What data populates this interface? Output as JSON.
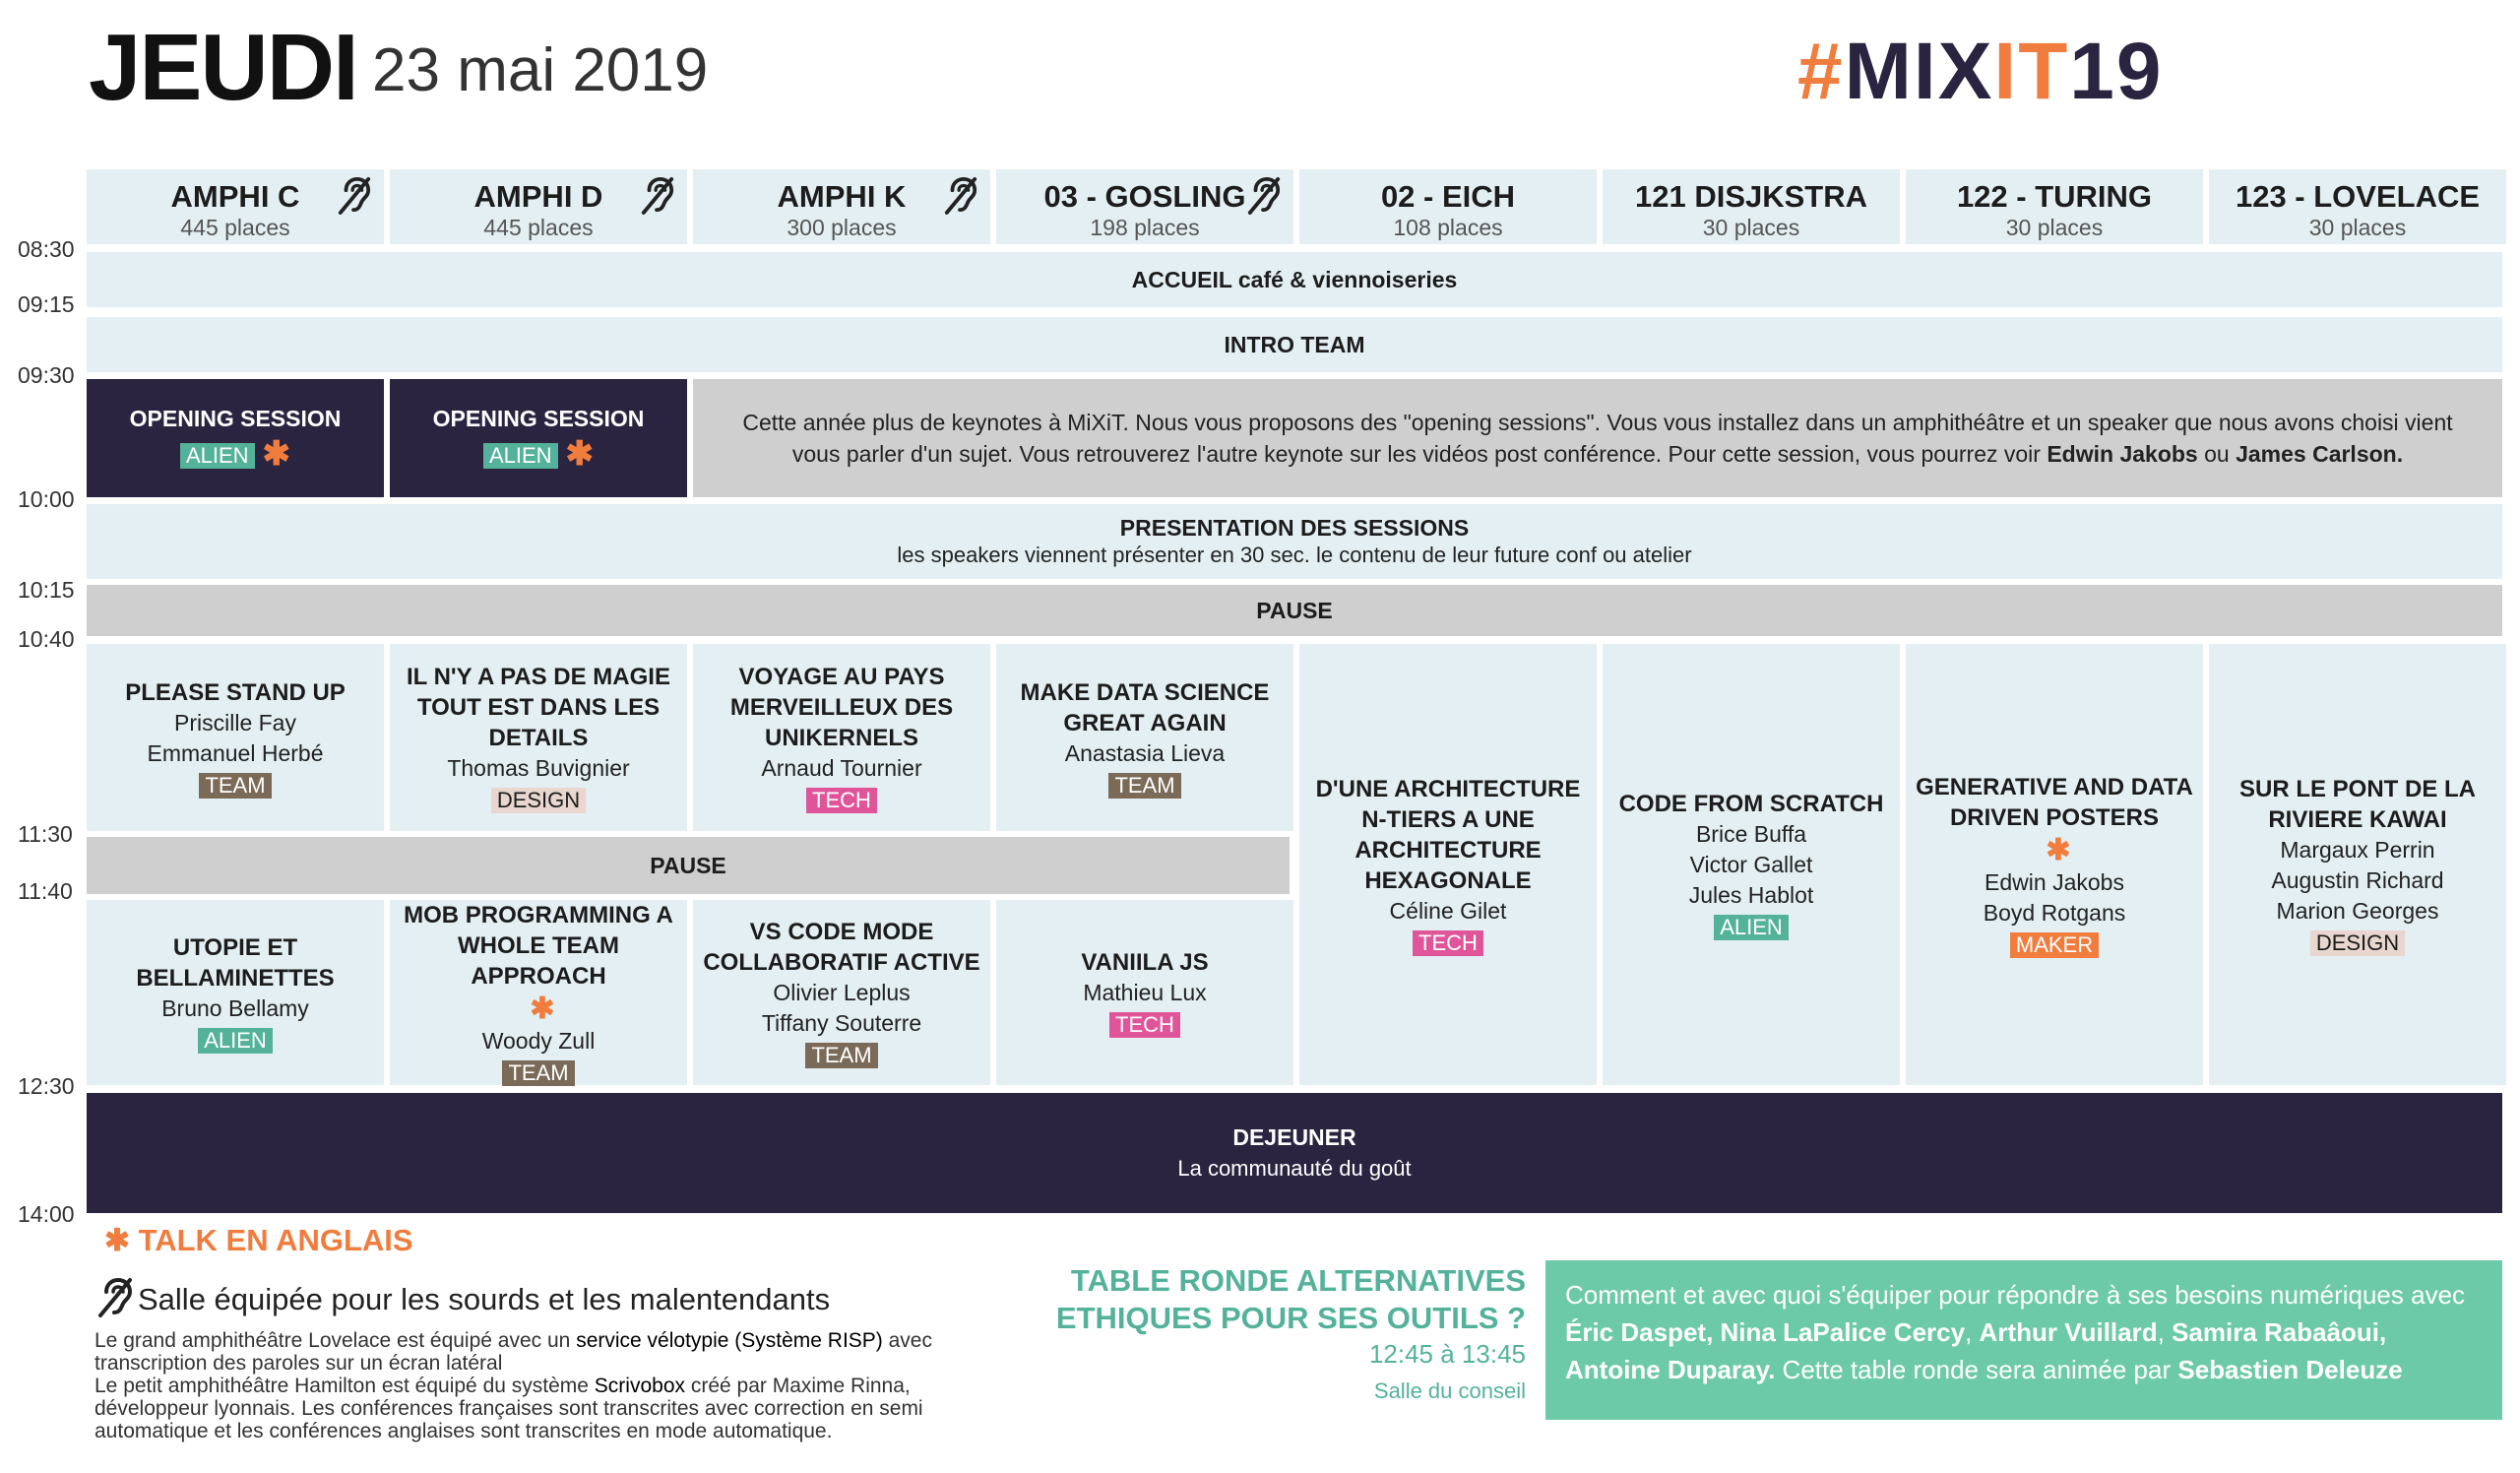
{
  "header": {
    "day": "JEUDI",
    "date": "23 mai 2019",
    "brand_hash": "#",
    "brand_mi": "MI",
    "brand_x": "X",
    "brand_it": "IT",
    "brand_num": "19"
  },
  "rooms": [
    {
      "name": "AMPHI C",
      "places": "445 places",
      "accessible": true
    },
    {
      "name": "AMPHI D",
      "places": "445 places",
      "accessible": true
    },
    {
      "name": "AMPHI K",
      "places": "300 places",
      "accessible": true
    },
    {
      "name": "03 - GOSLING",
      "places": "198 places",
      "accessible": true
    },
    {
      "name": "02 - EICH",
      "places": "108 places",
      "accessible": false
    },
    {
      "name": "121 DISJKSTRA",
      "places": "30 places",
      "accessible": false
    },
    {
      "name": "122 - TURING",
      "places": "30 places",
      "accessible": false
    },
    {
      "name": "123 - LOVELACE",
      "places": "30 places",
      "accessible": false
    }
  ],
  "times": [
    "08:30",
    "09:15",
    "09:30",
    "10:00",
    "10:15",
    "10:40",
    "11:30",
    "11:40",
    "12:30",
    "14:00"
  ],
  "plenary": {
    "accueil": "ACCUEIL café & viennoiseries",
    "intro": "INTRO TEAM",
    "presentation_title": "PRESENTATION DES SESSIONS",
    "presentation_sub": "les speakers viennent présenter en 30 sec. le contenu de leur future conf ou atelier",
    "pause1": "PAUSE",
    "pause2": "PAUSE",
    "dejeuner_title": "DEJEUNER",
    "dejeuner_sub": "La communauté du goût"
  },
  "opening": [
    {
      "title": "OPENING SESSION",
      "tag": "ALIEN",
      "english": true
    },
    {
      "title": "OPENING SESSION",
      "tag": "ALIEN",
      "english": true
    }
  ],
  "keynote_note": {
    "text1": "Cette année plus de keynotes à MiXiT. Nous vous proposons des \"opening sessions\". Vous vous installez dans un amphithéâtre et un speaker que nous avons choisi vient vous parler d'un sujet. Vous retrouverez l'autre keynote sur les vidéos post conférence. Pour cette session, vous pourrez voir ",
    "name1": "Edwin Jakobs",
    "text2": " ou  ",
    "name2": "James Carlson."
  },
  "sessions_morning": [
    {
      "title": "PLEASE STAND UP",
      "speakers": [
        "Priscille Fay",
        "Emmanuel Herbé"
      ],
      "tag": "TEAM"
    },
    {
      "title": "IL N'Y A PAS DE MAGIE TOUT EST DANS LES DETAILS",
      "speakers": [
        "Thomas Buvignier"
      ],
      "tag": "DESIGN"
    },
    {
      "title": "VOYAGE AU PAYS MERVEILLEUX DES UNIKERNELS",
      "speakers": [
        "Arnaud Tournier"
      ],
      "tag": "TECH"
    },
    {
      "title": "MAKE DATA SCIENCE GREAT AGAIN",
      "speakers": [
        "Anastasia Lieva"
      ],
      "tag": "TEAM"
    }
  ],
  "sessions_long": [
    {
      "title": "D'UNE ARCHITECTURE N-TIERS A UNE ARCHITECTURE HEXAGONALE",
      "speakers": [
        "Céline Gilet"
      ],
      "tag": "TECH",
      "english": false
    },
    {
      "title": "CODE FROM SCRATCH",
      "speakers": [
        "Brice Buffa",
        "Victor Gallet",
        "Jules Hablot"
      ],
      "tag": "ALIEN",
      "english": false
    },
    {
      "title": "GENERATIVE AND DATA DRIVEN POSTERS",
      "speakers": [
        "Edwin Jakobs",
        "Boyd Rotgans"
      ],
      "tag": "MAKER",
      "english": true
    },
    {
      "title": "SUR LE PONT DE LA RIVIERE KAWAI",
      "speakers": [
        "Margaux Perrin",
        "Augustin Richard",
        "Marion Georges"
      ],
      "tag": "DESIGN",
      "english": false
    }
  ],
  "sessions_late": [
    {
      "title": "UTOPIE ET BELLAMINETTES",
      "speakers": [
        "Bruno Bellamy"
      ],
      "tag": "ALIEN",
      "english": false
    },
    {
      "title": "MOB PROGRAMMING A WHOLE TEAM APPROACH",
      "speakers": [
        "Woody Zull"
      ],
      "tag": "TEAM",
      "english": true
    },
    {
      "title": "VS CODE MODE COLLABORATIF ACTIVE",
      "speakers": [
        "Olivier Leplus",
        "Tiffany Souterre"
      ],
      "tag": "TEAM",
      "english": false
    },
    {
      "title": "VANIILA JS",
      "speakers": [
        "Mathieu Lux"
      ],
      "tag": "TECH",
      "english": false
    }
  ],
  "legend": {
    "english": "TALK EN ANGLAIS",
    "accessible": "Salle équipée pour les sourds et les malentendants",
    "p1a": "Le grand amphithéâtre Lovelace est équipé avec un ",
    "p1b": "service vélotypie (Système RISP)",
    "p1c": " avec transcription des paroles sur un écran latéral",
    "p2a": "Le petit amphithéâtre Hamilton est équipé du système ",
    "p2b": "Scrivobox",
    "p2c": " créé par Maxime Rinna, développeur lyonnais. Les conférences françaises sont transcrites avec correction en semi automatique et les conférences anglaises sont transcrites en mode automatique."
  },
  "table_ronde": {
    "title": "TABLE RONDE ALTERNATIVES ETHIQUES POUR SES OUTILS ?",
    "time": "12:45 à 13:45",
    "room": "Salle du conseil",
    "t1": "Comment et avec quoi s'équiper pour répondre à ses besoins numériques avec ",
    "names": "Éric Daspet, Nina LaPalice Cercy",
    "sep1": ", ",
    "name3": "Arthur Vuillard",
    "sep2": ", ",
    "name4": "Samira Rabaâoui,",
    "sep3": " ",
    "name5": "Antoine Duparay.",
    "t2": " Cette table ronde sera animée par ",
    "name6": "Sebastien Deleuze"
  },
  "colors": {
    "accent_orange": "#f07c3e",
    "dark_purple": "#2a2440",
    "cell_bg": "#e3eff2",
    "grey_bg": "#cfcfcf",
    "green": "#54b29a",
    "tag_team": "#7a6a57",
    "tag_tech": "#e0559a",
    "tag_design": "#e8d6cf"
  },
  "icons": {
    "english": "asterisk-icon",
    "accessible": "ear-icon"
  }
}
